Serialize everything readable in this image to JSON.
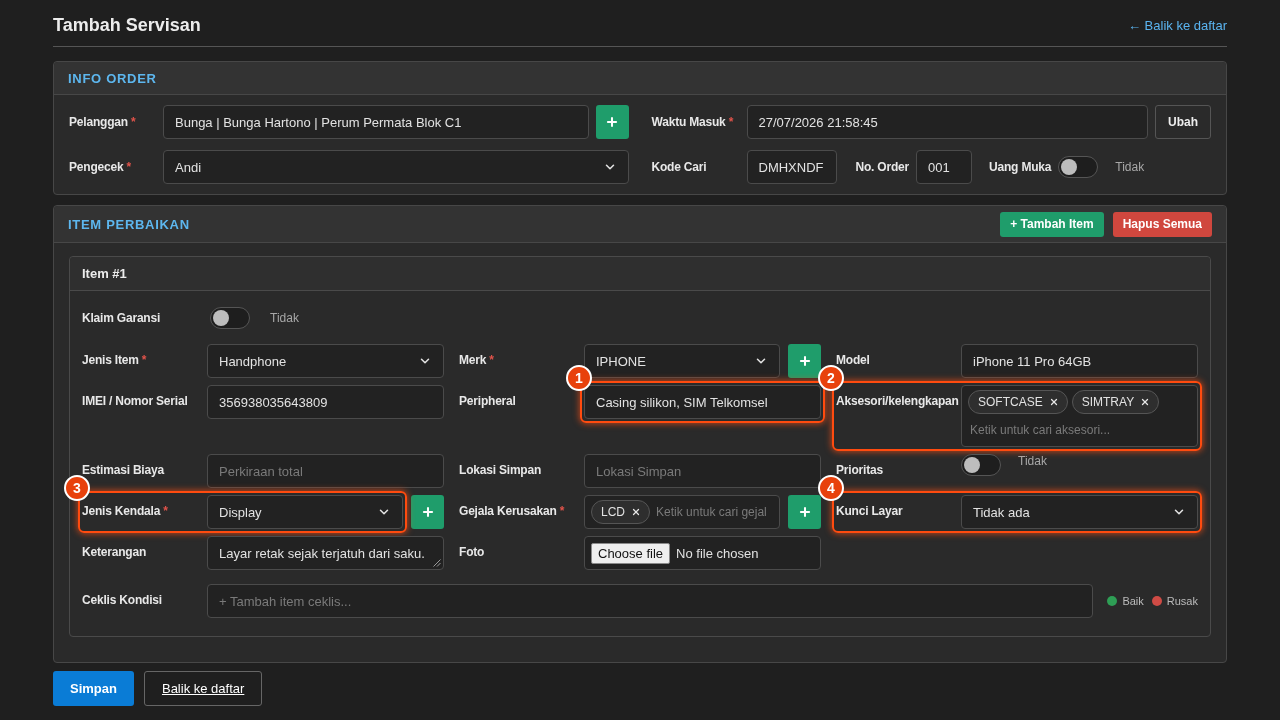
{
  "page": {
    "title": "Tambah Servisan",
    "back_link": "← Balik ke daftar"
  },
  "info_order": {
    "title": "INFO ORDER",
    "pelanggan": {
      "label": "Pelanggan",
      "required_mark": "*",
      "value": "Bunga | Bunga Hartono | Perum Permata Blok C1",
      "add_button": true
    },
    "waktu_masuk": {
      "label": "Waktu Masuk",
      "required_mark": "*",
      "value": "27/07/2026 21:58:45",
      "button": "Ubah"
    },
    "pengecek": {
      "label": "Pengecek",
      "required_mark": "*",
      "value": "Andi"
    },
    "kode_cari": {
      "label": "Kode Cari",
      "value": "DMHXNDF"
    },
    "no_order": {
      "label": "No. Order",
      "value": "001"
    },
    "uang_muka": {
      "label": "Uang Muka",
      "on": false,
      "state_text": "Tidak"
    }
  },
  "item_perbaikan": {
    "title": "ITEM PERBAIKAN",
    "actions": [
      {
        "label": "+ Tambah Item",
        "kind": "success"
      },
      {
        "label": "Hapus Semua",
        "kind": "danger"
      }
    ],
    "items": [
      {
        "title": "Item #1",
        "klaim_garansi": {
          "label": "Klaim Garansi",
          "on": false,
          "state_text": "Tidak"
        },
        "fields": [
          {
            "kind": "select",
            "label": "Jenis Item",
            "required_mark": "*",
            "value": "Handphone"
          },
          {
            "kind": "select",
            "label": "Merk",
            "required_mark": "*",
            "value": "IPHONE",
            "add_button": true
          },
          {
            "kind": "text",
            "label": "Model",
            "value": "iPhone 11 Pro 64GB"
          },
          {
            "kind": "text",
            "label": "IMEI / Nomor Serial",
            "value": "356938035643809"
          },
          {
            "kind": "text",
            "label": "Peripheral",
            "value": "Casing silikon, SIM Telkomsel",
            "callout": {
              "number": "1",
              "kind": "input"
            }
          },
          {
            "kind": "tags",
            "label": "Aksesori/kelengkapan",
            "tags": [
              "SOFTCASE",
              "SIMTRAY"
            ],
            "placeholder": "Ketik untuk cari aksesori...",
            "callout": {
              "number": "2",
              "kind": "row"
            }
          },
          {
            "kind": "text",
            "label": "Estimasi Biaya",
            "placeholder": "Perkiraan total"
          },
          {
            "kind": "text",
            "label": "Lokasi Simpan",
            "placeholder": "Lokasi Simpan"
          },
          {
            "kind": "toggle",
            "label": "Prioritas",
            "on": false,
            "state_text": "Tidak"
          },
          {
            "kind": "select",
            "label": "Jenis Kendala",
            "required_mark": "*",
            "value": "Display",
            "add_button": true,
            "callout": {
              "number": "3",
              "kind": "row"
            }
          },
          {
            "kind": "tags",
            "label": "Gejala Kerusakan",
            "required_mark": "*",
            "tags": [
              "LCD"
            ],
            "placeholder": "Ketik untuk cari gejal",
            "add_button": true
          },
          {
            "kind": "select",
            "label": "Kunci Layar",
            "value": "Tidak ada",
            "callout": {
              "number": "4",
              "kind": "row"
            }
          },
          {
            "kind": "textarea",
            "label": "Keterangan",
            "value": "Layar retak sejak terjatuh dari saku."
          },
          {
            "kind": "file",
            "label": "Foto",
            "button_label": "Choose file",
            "status": "No file chosen"
          }
        ],
        "ceklis_kondisi": {
          "label": "Ceklis Kondisi",
          "placeholder": "+ Tambah item ceklis...",
          "legend": [
            {
              "label": "Baik",
              "color": "#2e9e55"
            },
            {
              "label": "Rusak",
              "color": "#cf4b45"
            }
          ]
        }
      }
    ]
  },
  "footer": {
    "buttons": [
      {
        "label": "Simpan",
        "kind": "primary"
      },
      {
        "label": "Balik ke daftar",
        "kind": "outline"
      }
    ]
  }
}
